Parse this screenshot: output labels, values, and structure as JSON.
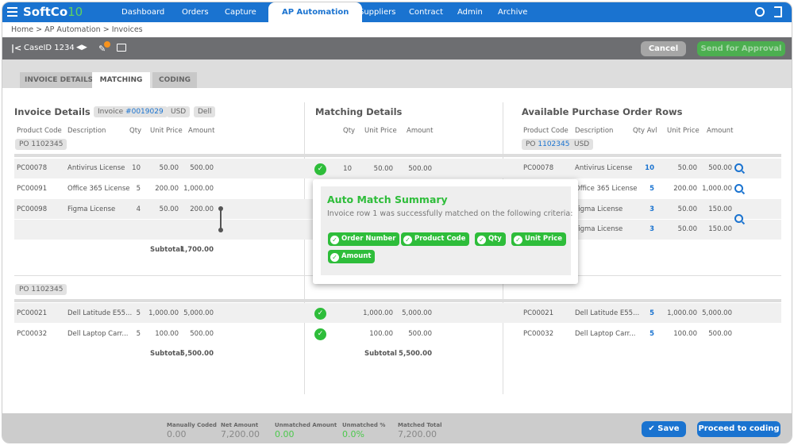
{
  "nav": {
    "brand": "SoftCo",
    "brand_suffix": "10",
    "items": [
      "Dashboard",
      "Orders",
      "Capture",
      "AP Automation",
      "Suppliers",
      "Contract",
      "Admin",
      "Archive"
    ],
    "active": "AP Automation"
  },
  "breadcrumb": [
    "Home",
    ">",
    "AP Automation",
    ">",
    "Invoices"
  ],
  "toolbar": {
    "case": "CaseID 1234",
    "cancel": "Cancel",
    "send": "Send for Approval"
  },
  "tabs": [
    "INVOICE DETAILS",
    "MATCHING",
    "CODING"
  ],
  "invoice": {
    "title": "Invoice Details",
    "invoice_label": "Invoice ",
    "invoice_no": "#0019029",
    "currency": "USD",
    "supplier": "Dell",
    "headers": [
      "Product Code",
      "Description",
      "Qty",
      "Unit Price",
      "Amount"
    ],
    "po1": "PO 1102345",
    "po2": "PO 1102345",
    "rows1": [
      [
        "PC00078",
        "Antivirus License",
        "10",
        "50.00",
        "500.00"
      ],
      [
        "PC00091",
        "Office 365 License",
        "5",
        "200.00",
        "1,000.00"
      ],
      [
        "PC00098",
        "Figma License",
        "4",
        "50.00",
        "200.00"
      ]
    ],
    "subtotal_label": "Subtotal",
    "subtotal1": "1,700.00",
    "rows2": [
      [
        "PC00021",
        "Dell Latitude E55...",
        "5",
        "1,000.00",
        "5,000.00"
      ],
      [
        "PC00032",
        "Dell Laptop Carr...",
        "5",
        "100.00",
        "500.00"
      ]
    ],
    "subtotal2": "5,500.00"
  },
  "matching": {
    "title": "Matching Details",
    "headers": [
      "Qty",
      "Unit Price",
      "Amount"
    ],
    "rows1": [
      [
        "10",
        "50.00",
        "500.00"
      ]
    ],
    "rows2": [
      [
        "",
        "1,000.00",
        "5,000.00"
      ],
      [
        "",
        "100.00",
        "500.00"
      ]
    ],
    "subtotal_label": "Subtotal",
    "subtotal2": "5,500.00"
  },
  "po_rows": {
    "title": "Available Purchase Order Rows",
    "headers": [
      "Product Code",
      "Description",
      "Qty Avl",
      "Unit Price",
      "Amount"
    ],
    "po_label": "PO ",
    "po_no": "1102345",
    "currency": "USD",
    "rows1": [
      [
        "PC00078",
        "Antivirus License",
        "10",
        "50.00",
        "500.00"
      ],
      [
        "",
        "Office 365 License",
        "5",
        "200.00",
        "1,000.00"
      ],
      [
        "",
        "Figma License",
        "3",
        "50.00",
        "150.00"
      ],
      [
        "",
        "Figma License",
        "3",
        "50.00",
        "150.00"
      ]
    ],
    "rows2": [
      [
        "PC00021",
        "Dell Latitude E55...",
        "5",
        "1,000.00",
        "5,000.00"
      ],
      [
        "PC00032",
        "Dell Laptop Carr...",
        "5",
        "100.00",
        "500.00"
      ]
    ]
  },
  "popup": {
    "title": "Auto Match Summary",
    "text": "Invoice row 1 was successfully matched on the following criteria:",
    "criteria": [
      "Order Number",
      "Product Code",
      "Qty",
      "Unit Price",
      "Amount"
    ]
  },
  "footer": {
    "stats": [
      {
        "label": "Manually Coded",
        "value": "0.00"
      },
      {
        "label": "Net Amount",
        "value": "7,200.00"
      },
      {
        "label": "Unmatched Amount",
        "value": "0.00"
      },
      {
        "label": "Unmatched %",
        "value": "0.0%"
      },
      {
        "label": "Matched Total",
        "value": "7,200.00"
      }
    ],
    "save": "Save",
    "proceed": "Proceed to coding"
  },
  "colors": {
    "primary": "#1a73d0",
    "success": "#2ebd3a",
    "approve": "#4caf50",
    "toolbar": "#6d6e71"
  }
}
